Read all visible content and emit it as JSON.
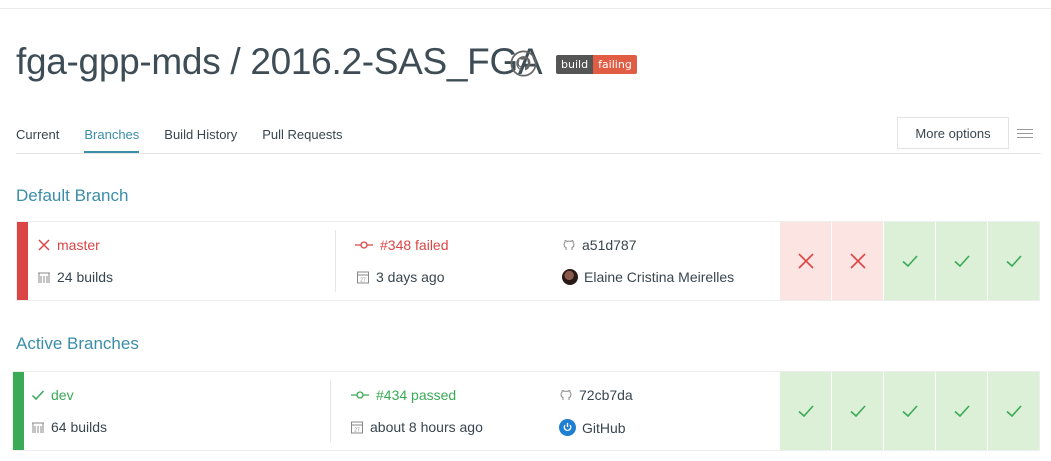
{
  "repo": {
    "title": "fga-gpp-mds / 2016.2-SAS_FGA",
    "badge_left": "build",
    "badge_right": "failing"
  },
  "tabs": [
    {
      "label": "Current",
      "active": false
    },
    {
      "label": "Branches",
      "active": true
    },
    {
      "label": "Build History",
      "active": false
    },
    {
      "label": "Pull Requests",
      "active": false
    }
  ],
  "more_options": "More options",
  "default_branch": {
    "heading": "Default Branch",
    "name": "master",
    "builds": "24 builds",
    "build_status": "#348 failed",
    "time": "3 days ago",
    "commit": "a51d787",
    "author": "Elaine Cristina Meirelles",
    "state": "failed",
    "history": [
      "failed",
      "failed",
      "passed",
      "passed",
      "passed"
    ]
  },
  "active_branches": {
    "heading": "Active Branches",
    "items": [
      {
        "name": "dev",
        "builds": "64 builds",
        "build_status": "#434 passed",
        "time": "about 8 hours ago",
        "commit": "72cb7da",
        "author": "GitHub",
        "state": "passed",
        "history": [
          "passed",
          "passed",
          "passed",
          "passed",
          "passed"
        ]
      }
    ]
  },
  "colors": {
    "accent": "#3a8ea8",
    "failed": "#db4545",
    "passed": "#39aa56",
    "failed_bg": "#fbe4e1",
    "passed_bg": "#dcefd7"
  }
}
